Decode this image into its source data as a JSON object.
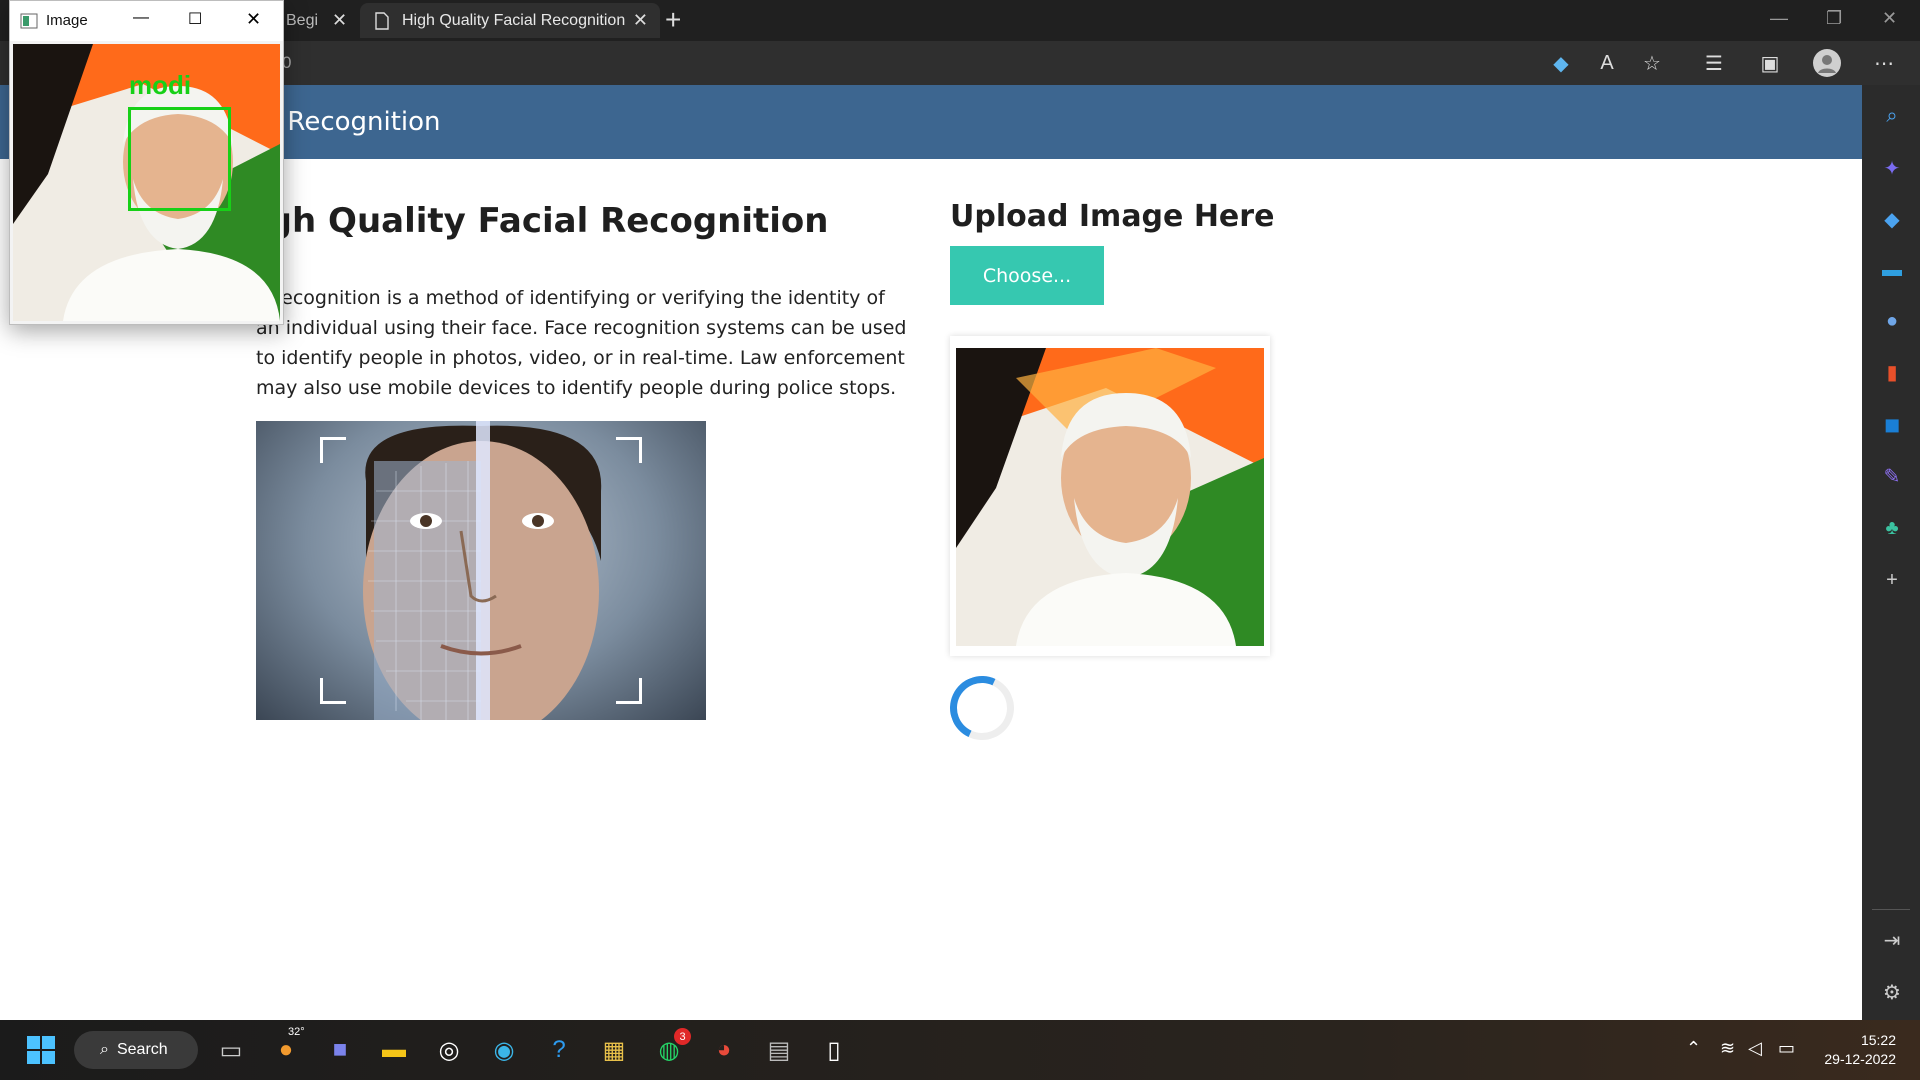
{
  "browser": {
    "tabs": [
      {
        "label": "Begi",
        "active": false
      },
      {
        "label": "High Quality Facial Recognition",
        "active": true
      }
    ],
    "address_text": "0",
    "accent": "#3d6690"
  },
  "navbar": {
    "brand": "al Recognition"
  },
  "main": {
    "heading": "igh Quality Facial Recognition",
    "description": "e recognition is a method of identifying or verifying the identity of an individual using their face. Face recognition systems can be used to identify people in photos, video, or in real-time. Law enforcement may also use mobile devices to identify people during police stops."
  },
  "upload": {
    "heading": "Upload Image Here",
    "choose_label": "Choose...",
    "button_color": "#36c8b0"
  },
  "image_window": {
    "title": "Image",
    "detection_label": "modi",
    "box_color": "#17d017"
  },
  "taskbar": {
    "search_label": "Search",
    "weather_temp": "32°",
    "whatsapp_badge": "3",
    "time": "15:22",
    "date": "29-12-2022"
  }
}
